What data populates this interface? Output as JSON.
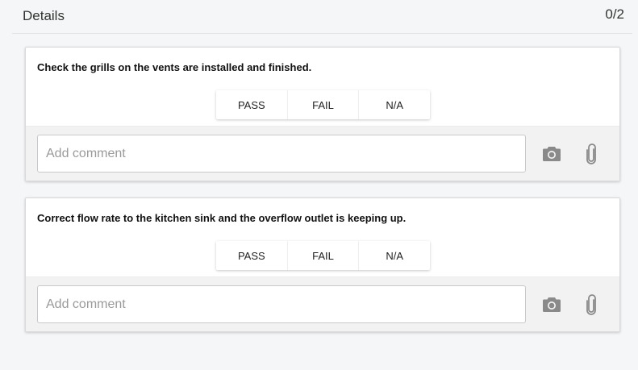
{
  "header": {
    "title": "Details",
    "count": "0/2"
  },
  "items": [
    {
      "question": "Check the grills on the vents are installed and finished.",
      "options": [
        "PASS",
        "FAIL",
        "N/A"
      ],
      "comment_placeholder": "Add comment",
      "comment_value": ""
    },
    {
      "question": "Correct flow rate to the kitchen sink and the overflow outlet is keeping up.",
      "options": [
        "PASS",
        "FAIL",
        "N/A"
      ],
      "comment_placeholder": "Add comment",
      "comment_value": ""
    }
  ],
  "icons": {
    "camera": "camera-icon",
    "attach": "paperclip-icon"
  },
  "colors": {
    "icon": "#8a8a8a",
    "background": "#f5f6f7",
    "card": "#ffffff"
  }
}
